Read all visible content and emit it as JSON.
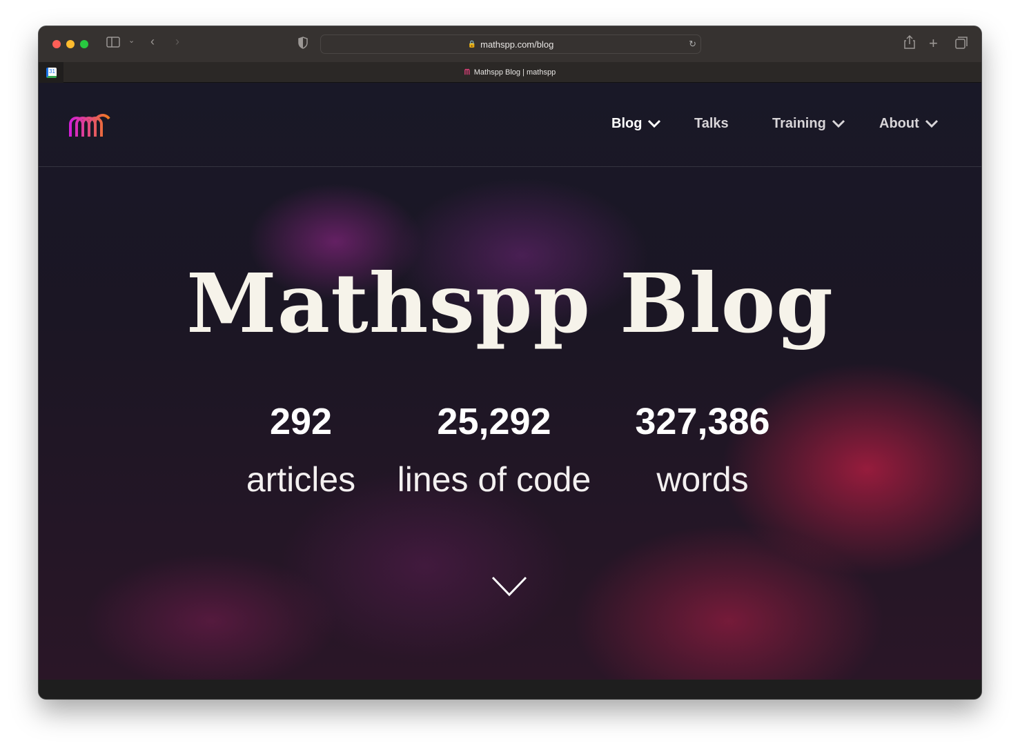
{
  "browser": {
    "url": "mathspp.com/blog",
    "tab_title": "Mathspp Blog | mathspp",
    "pinned_tab_icon": "calendar-icon",
    "pinned_tab_text": "31"
  },
  "nav": {
    "items": [
      {
        "label": "Blog",
        "dropdown": true,
        "active": true
      },
      {
        "label": "Talks",
        "dropdown": false
      },
      {
        "label": "Training",
        "dropdown": true
      },
      {
        "label": "About",
        "dropdown": true
      }
    ]
  },
  "hero": {
    "title": "Mathspp Blog",
    "stats": [
      {
        "value": "292",
        "label": "articles"
      },
      {
        "value": "25,292",
        "label": "lines of code"
      },
      {
        "value": "327,386",
        "label": "words"
      }
    ]
  },
  "colors": {
    "logo_start": "#d21fd6",
    "logo_end": "#f07a1e"
  }
}
